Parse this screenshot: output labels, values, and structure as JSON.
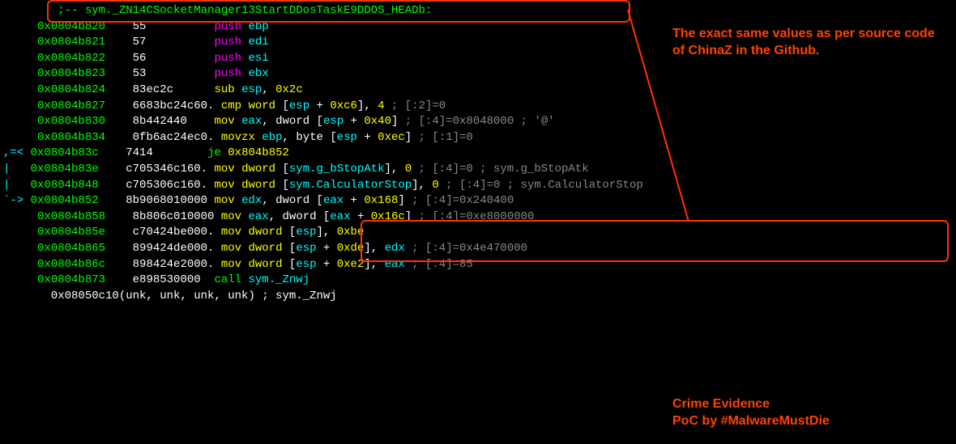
{
  "function_label": ";-- sym._ZN14CSocketManager13StartDDosTaskE9DDOS_HEADb:",
  "lines": [
    {
      "pre": "     ",
      "addr": "0x0804b820",
      "hex": "55         ",
      "mn": "push",
      "mncolor": "m",
      "ops": [
        {
          "t": "reg",
          "v": "ebp"
        }
      ]
    },
    {
      "pre": "     ",
      "addr": "0x0804b821",
      "hex": "57         ",
      "mn": "push",
      "mncolor": "m",
      "ops": [
        {
          "t": "reg",
          "v": "edi"
        }
      ]
    },
    {
      "pre": "     ",
      "addr": "0x0804b822",
      "hex": "56         ",
      "mn": "push",
      "mncolor": "m",
      "ops": [
        {
          "t": "reg",
          "v": "esi"
        }
      ]
    },
    {
      "pre": "     ",
      "addr": "0x0804b823",
      "hex": "53         ",
      "mn": "push",
      "mncolor": "m",
      "ops": [
        {
          "t": "reg",
          "v": "ebx"
        }
      ]
    },
    {
      "pre": "     ",
      "addr": "0x0804b824",
      "hex": "83ec2c     ",
      "mn": "sub",
      "mncolor": "y",
      "ops": [
        {
          "t": "reg",
          "v": "esp"
        },
        {
          "t": "txt",
          "v": ", "
        },
        {
          "t": "num",
          "v": "0x2c"
        }
      ]
    },
    {
      "pre": "     ",
      "addr": "0x0804b827",
      "hex": "6683bc24c60.",
      "mn": "cmp word",
      "mncolor": "y",
      "ops": [
        {
          "t": "txt",
          "v": "["
        },
        {
          "t": "reg",
          "v": "esp"
        },
        {
          "t": "txt",
          "v": " + "
        },
        {
          "t": "num",
          "v": "0xc6"
        },
        {
          "t": "txt",
          "v": "], "
        },
        {
          "t": "num",
          "v": "4"
        }
      ],
      "cmt": " ; [:2]=0"
    },
    {
      "pre": "     ",
      "addr": "0x0804b830",
      "hex": "8b442440   ",
      "mn": "mov",
      "mncolor": "y",
      "ops": [
        {
          "t": "reg",
          "v": "eax"
        },
        {
          "t": "txt",
          "v": ", dword ["
        },
        {
          "t": "reg",
          "v": "esp"
        },
        {
          "t": "txt",
          "v": " + "
        },
        {
          "t": "num",
          "v": "0x40"
        },
        {
          "t": "txt",
          "v": "]"
        }
      ],
      "cmt": " ; [:4]=0x8048000 ; '@'"
    },
    {
      "pre": "     ",
      "addr": "0x0804b834",
      "hex": "0fb6ac24ec0.",
      "mn": "movzx",
      "mncolor": "y",
      "ops": [
        {
          "t": "reg",
          "v": "ebp"
        },
        {
          "t": "txt",
          "v": ", byte ["
        },
        {
          "t": "reg",
          "v": "esp"
        },
        {
          "t": "txt",
          "v": " + "
        },
        {
          "t": "num",
          "v": "0xec"
        },
        {
          "t": "txt",
          "v": "]"
        }
      ],
      "cmt": " ; [:1]=0"
    },
    {
      "pre": ",=< ",
      "addr": "0x0804b83c",
      "hex": "7414       ",
      "mn": "je",
      "mncolor": "g",
      "ops": [
        {
          "t": "num",
          "v": "0x804b852"
        }
      ]
    },
    {
      "pre": "|   ",
      "addr": "0x0804b83e",
      "hex": "c705346c160.",
      "mn": "mov dword",
      "mncolor": "y",
      "ops": [
        {
          "t": "txt",
          "v": "["
        },
        {
          "t": "sym",
          "v": "sym.g_bStopAtk"
        },
        {
          "t": "txt",
          "v": "], "
        },
        {
          "t": "num",
          "v": "0"
        }
      ],
      "cmt": " ; [:4]=0 ; sym.g_bStopAtk"
    },
    {
      "pre": "|   ",
      "addr": "0x0804b848",
      "hex": "c705306c160.",
      "mn": "mov dword",
      "mncolor": "y",
      "ops": [
        {
          "t": "txt",
          "v": "["
        },
        {
          "t": "sym",
          "v": "sym.CalculatorStop"
        },
        {
          "t": "txt",
          "v": "], "
        },
        {
          "t": "num",
          "v": "0"
        }
      ],
      "cmt": " ; [:4]=0 ; sym.CalculatorStop"
    },
    {
      "pre": "`-> ",
      "addr": "0x0804b852",
      "hex": "8b9068010000",
      "mn": "mov",
      "mncolor": "y",
      "ops": [
        {
          "t": "reg",
          "v": "edx"
        },
        {
          "t": "txt",
          "v": ", dword ["
        },
        {
          "t": "reg",
          "v": "eax"
        },
        {
          "t": "txt",
          "v": " + "
        },
        {
          "t": "num",
          "v": "0x168"
        },
        {
          "t": "txt",
          "v": "]"
        }
      ],
      "cmt": " ; [:4]=0x240400"
    },
    {
      "pre": "     ",
      "addr": "0x0804b858",
      "hex": "8b806c010000",
      "mn": "mov",
      "mncolor": "y",
      "ops": [
        {
          "t": "reg",
          "v": "eax"
        },
        {
          "t": "txt",
          "v": ", dword ["
        },
        {
          "t": "reg",
          "v": "eax"
        },
        {
          "t": "txt",
          "v": " + "
        },
        {
          "t": "num",
          "v": "0x16c"
        },
        {
          "t": "txt",
          "v": "]"
        }
      ],
      "cmt": " ; [:4]=0xe8000000"
    },
    {
      "pre": "     ",
      "addr": "0x0804b85e",
      "hex": "c70424be000.",
      "mn": "mov dword",
      "mncolor": "y",
      "ops": [
        {
          "t": "txt",
          "v": "["
        },
        {
          "t": "reg",
          "v": "esp"
        },
        {
          "t": "txt",
          "v": "], "
        },
        {
          "t": "num",
          "v": "0xbe"
        }
      ]
    },
    {
      "pre": "     ",
      "addr": "0x0804b865",
      "hex": "899424de000.",
      "mn": "mov dword",
      "mncolor": "y",
      "ops": [
        {
          "t": "txt",
          "v": "["
        },
        {
          "t": "reg",
          "v": "esp"
        },
        {
          "t": "txt",
          "v": " + "
        },
        {
          "t": "num",
          "v": "0xde"
        },
        {
          "t": "txt",
          "v": "], "
        },
        {
          "t": "reg",
          "v": "edx"
        }
      ],
      "cmt": " ; [:4]=0x4e470000"
    },
    {
      "pre": "     ",
      "addr": "0x0804b86c",
      "hex": "898424e2000.",
      "mn": "mov dword",
      "mncolor": "y",
      "ops": [
        {
          "t": "txt",
          "v": "["
        },
        {
          "t": "reg",
          "v": "esp"
        },
        {
          "t": "txt",
          "v": " + "
        },
        {
          "t": "num",
          "v": "0xe2"
        },
        {
          "t": "txt",
          "v": "], "
        },
        {
          "t": "reg",
          "v": "eax"
        }
      ],
      "cmt": " ; [:4]=85"
    },
    {
      "pre": "     ",
      "addr": "0x0804b873",
      "hex": "e898530000 ",
      "mn": "call",
      "mncolor": "g",
      "ops": [
        {
          "t": "sym",
          "v": "sym._Znwj"
        }
      ]
    }
  ],
  "footer": "       0x08050c10(unk, unk, unk, unk) ; sym._Znwj",
  "annotation1": "The exact same values as per source code of ChinaZ in the Github.",
  "annotation2a": "Crime Evidence",
  "annotation2b": "PoC by #MalwareMustDie"
}
